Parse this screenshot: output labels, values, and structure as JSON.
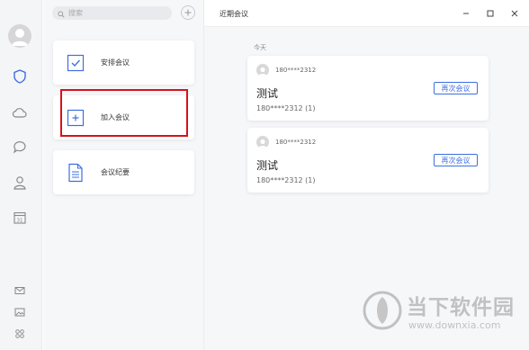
{
  "rail": {
    "items": [
      {
        "name": "meetings"
      },
      {
        "name": "cloud"
      },
      {
        "name": "chat"
      },
      {
        "name": "contacts"
      },
      {
        "name": "calendar",
        "label": "31"
      }
    ],
    "bottom": [
      "mail",
      "image",
      "apps"
    ]
  },
  "middle": {
    "search": {
      "placeholder": "搜索"
    },
    "actions": [
      {
        "label": "安排会议",
        "icon": "checkbox-icon"
      },
      {
        "label": "加入会议",
        "icon": "plus-square-icon"
      },
      {
        "label": "会议纪要",
        "icon": "document-icon"
      }
    ]
  },
  "right": {
    "title": "近期会议",
    "day_label": "今天",
    "meetings": [
      {
        "user": "180****2312",
        "title": "测试",
        "subtitle": "180****2312 (1)",
        "button": "再次会议"
      },
      {
        "user": "180****2312",
        "title": "测试",
        "subtitle": "180****2312 (1)",
        "button": "再次会议"
      }
    ]
  },
  "watermark": {
    "text": "当下软件园",
    "url": "www.downxia.com"
  },
  "colors": {
    "accent": "#3d6fe0",
    "highlight": "#d4131a"
  }
}
